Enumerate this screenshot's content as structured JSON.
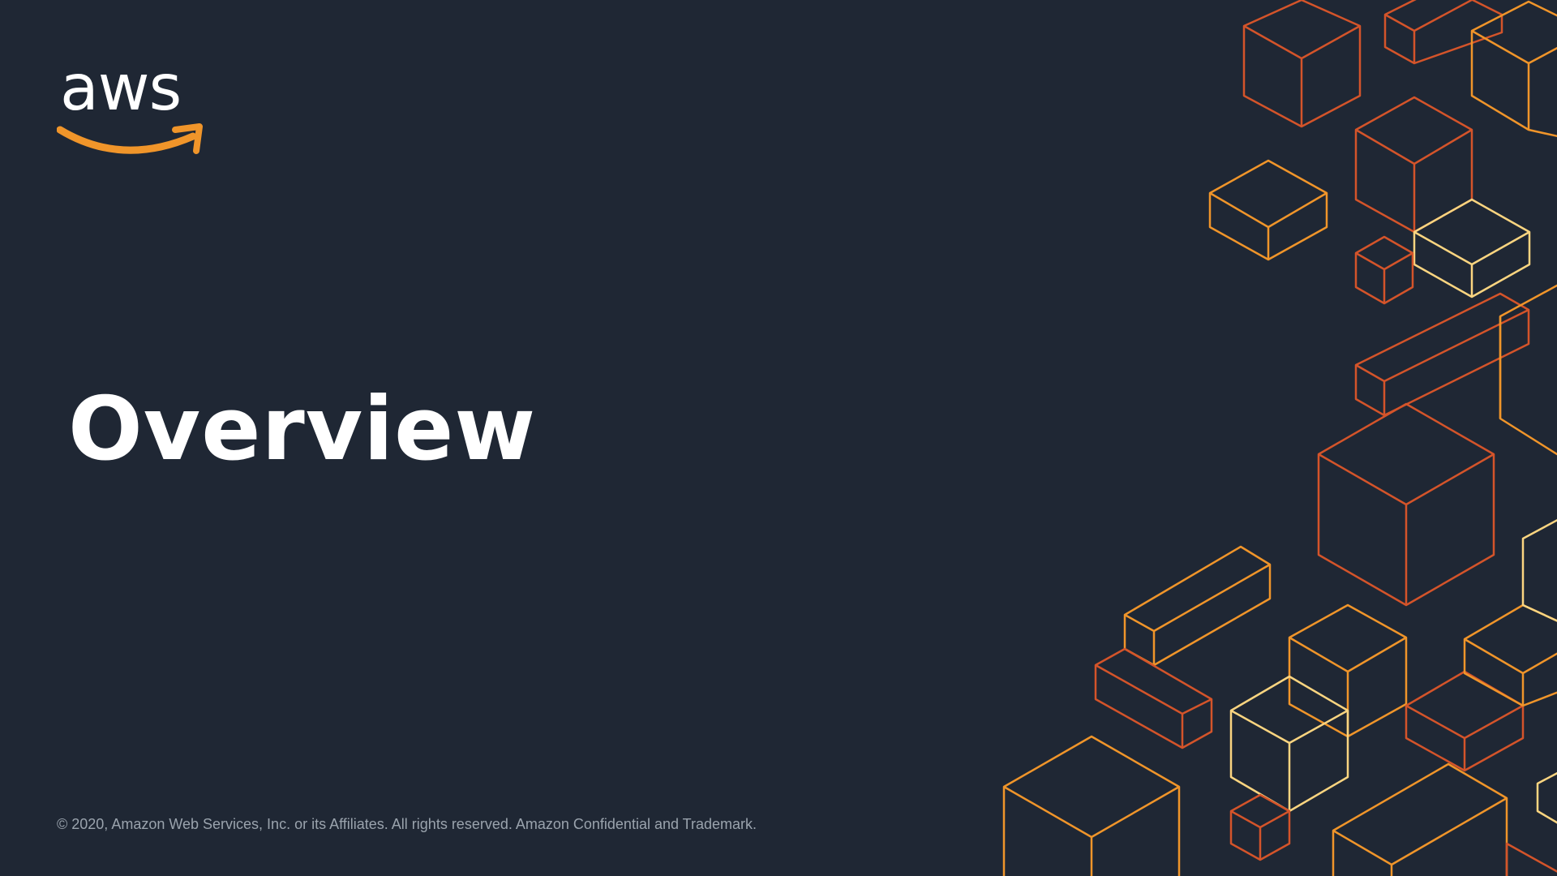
{
  "slide": {
    "logo_text": "aws",
    "logo_icon": "amazon-smile-arrow-icon",
    "title": "Overview",
    "footer": "© 2020, Amazon Web Services, Inc. or its Affiliates. All rights reserved. Amazon Confidential and Trademark."
  },
  "colors": {
    "background": "#1f2734",
    "text": "#ffffff",
    "footer_text": "#9aa3ad",
    "accent_orange": "#f0952a",
    "accent_red_orange": "#d4542a",
    "accent_cream": "#fbd580"
  }
}
